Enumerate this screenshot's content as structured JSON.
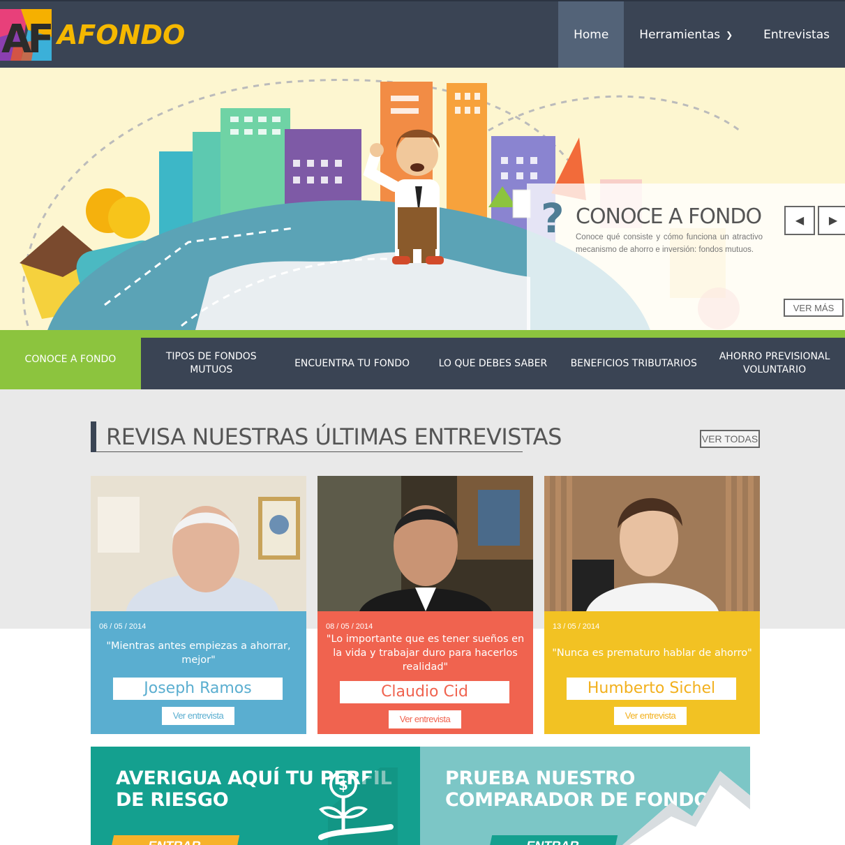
{
  "brand": {
    "name": "AFONDO",
    "logo_letters": "AF"
  },
  "nav": {
    "items": [
      {
        "label": "Home",
        "active": true
      },
      {
        "label": "Herramientas",
        "has_dropdown": true
      },
      {
        "label": "Entrevistas"
      }
    ]
  },
  "hero": {
    "title": "CONOCE A FONDO",
    "text": "Conoce qué consiste y cómo funciona un atractivo mecanismo de ahorro e inversión: fondos mutuos.",
    "cta": "VER MÁS",
    "prev_icon": "chevron-left-icon",
    "next_icon": "chevron-right-icon"
  },
  "tabs": [
    {
      "label": "CONOCE A FONDO",
      "active": true
    },
    {
      "label": "TIPOS DE FONDOS MUTUOS"
    },
    {
      "label": "ENCUENTRA TU FONDO"
    },
    {
      "label": "LO QUE DEBES SABER"
    },
    {
      "label": "BENEFICIOS TRIBUTARIOS"
    },
    {
      "label": "AHORRO PREVISIONAL VOLUNTARIO"
    }
  ],
  "interviews": {
    "title": "REVISA NUESTRAS ÚLTIMAS ENTREVISTAS",
    "see_all": "VER TODAS",
    "cards": [
      {
        "date": "06 / 05 / 2014",
        "quote": "\"Mientras antes empiezas a ahorrar, mejor\"",
        "name": "Joseph Ramos",
        "link": "Ver entrevista",
        "color": "#5aaed0"
      },
      {
        "date": "08 / 05 / 2014",
        "quote": "\"Lo importante que es tener sueños en la vida y trabajar duro para hacerlos realidad\"",
        "name": "Claudio Cid",
        "link": "Ver entrevista",
        "color": "#f0634f"
      },
      {
        "date": "13 / 05 / 2014",
        "quote": "\"Nunca es prematuro hablar de ahorro\"",
        "name": "Humberto Sichel",
        "link": "Ver entrevista",
        "color": "#f2c223"
      }
    ]
  },
  "promos": [
    {
      "title": "AVERIGUA AQUÍ TU PERFIL DE RIESGO",
      "cta": "ENTRAR",
      "color": "#14a08f",
      "icon": "money-plant-hand-icon"
    },
    {
      "title": "PRUEBA NUESTRO COMPARADOR DE FONDOS",
      "cta": "ENTRAR",
      "color": "#7cc6c6",
      "icon": "mountain-chart-icon"
    }
  ]
}
